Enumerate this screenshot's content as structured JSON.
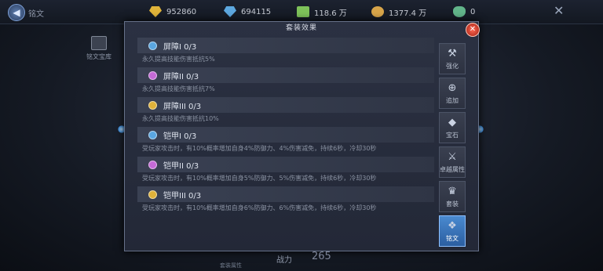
{
  "topbar": {
    "title": "铭文",
    "resources": [
      {
        "value": "952860",
        "color": "#e0b43a",
        "icon": "gold-gem-icon"
      },
      {
        "value": "694115",
        "color": "#5da8e0",
        "icon": "blue-gem-icon"
      },
      {
        "value": "118.6 万",
        "color": "#7ec25a",
        "icon": "cash-icon"
      },
      {
        "value": "1377.4 万",
        "color": "#d8a54a",
        "icon": "coin-bag-icon"
      },
      {
        "value": "0",
        "color": "#62b58a",
        "icon": "potion-icon"
      }
    ]
  },
  "left_panel": {
    "chest_label": "铭文宝库"
  },
  "dialog": {
    "title": "套装效果",
    "sets": [
      {
        "name": "屏障I 0/3",
        "desc": "永久提高技能伤害抵抗5%",
        "color": "#5aa6e0"
      },
      {
        "name": "屏障II 0/3",
        "desc": "永久提高技能伤害抵抗7%",
        "color": "#c46ad6"
      },
      {
        "name": "屏障III 0/3",
        "desc": "永久提高技能伤害抵抗10%",
        "color": "#e0b23a"
      },
      {
        "name": "铠甲I 0/3",
        "desc": "受玩家攻击时，有10%概率增加自身4%防御力、4%伤害减免，持续6秒，冷却30秒",
        "color": "#5aa6e0"
      },
      {
        "name": "铠甲II 0/3",
        "desc": "受玩家攻击时，有10%概率增加自身5%防御力、5%伤害减免，持续6秒，冷却30秒",
        "color": "#c46ad6"
      },
      {
        "name": "铠甲III 0/3",
        "desc": "受玩家攻击时，有10%概率增加自身6%防御力、6%伤害减免，持续6秒，冷却30秒",
        "color": "#e0b23a"
      }
    ]
  },
  "tabs": [
    {
      "label": "强化",
      "icon": "anvil-icon",
      "glyph": "⚒",
      "active": false
    },
    {
      "label": "追加",
      "icon": "plus-circle-icon",
      "glyph": "⊕",
      "active": false
    },
    {
      "label": "宝石",
      "icon": "gem-icon",
      "glyph": "◆",
      "active": false
    },
    {
      "label": "卓越属性",
      "icon": "sword-icon",
      "glyph": "⚔",
      "active": false
    },
    {
      "label": "套装",
      "icon": "armor-set-icon",
      "glyph": "♛",
      "active": false
    },
    {
      "label": "铭文",
      "icon": "inscription-icon",
      "glyph": "❖",
      "active": true
    }
  ],
  "footer": {
    "small_label": "套装属性",
    "power_label": "战力",
    "power_value": "265"
  }
}
